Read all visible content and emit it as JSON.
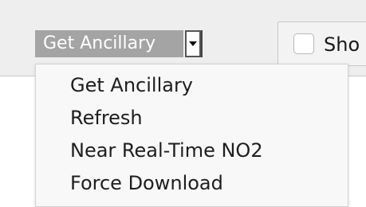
{
  "ancillary_dropdown": {
    "selected_label": "Get Ancillary",
    "arrow_icon": "dropdown-arrow-icon",
    "selected_bg": "#a4a4a4",
    "options": [
      "Get Ancillary",
      "Refresh",
      "Near Real-Time NO2",
      "Force Download"
    ]
  },
  "show_option": {
    "label": "Sho",
    "checked": false
  }
}
